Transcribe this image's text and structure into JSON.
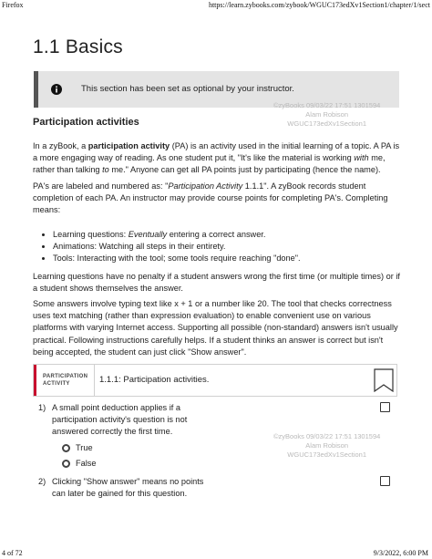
{
  "print_header": {
    "browser": "Firefox",
    "url": "https://learn.zybooks.com/zybook/WGUC173edXv1Section1/chapter/1/sect"
  },
  "print_footer": {
    "page": "4 of 72",
    "datetime": "9/3/2022, 6:00 PM"
  },
  "page_title": "1.1 Basics",
  "notice": {
    "text": "This section has been set as optional by your instructor.",
    "icon": "info-icon"
  },
  "watermarks": [
    {
      "line1": "©zyBooks 09/03/22 17:51 1301594",
      "line2": "Alam Robison",
      "line3": "WGUC173edXv1Section1"
    },
    {
      "line1": "©zyBooks 09/03/22 17:51 1301594",
      "line2": "Alam Robison",
      "line3": "WGUC173edXv1Section1"
    }
  ],
  "section_heading": "Participation activities",
  "paragraphs": {
    "p1_a": "In a zyBook, a ",
    "p1_bold": "participation activity",
    "p1_b": " (PA) is an activity used in the initial learning of a topic. A PA is a more engaging way of reading. As one student put it, \"It's like the material is working ",
    "p1_em1": "with",
    "p1_c": " me, rather than talking ",
    "p1_em2": "to",
    "p1_d": " me.\" Anyone can get all PA points just by participating (hence the name).",
    "p2_a": "PA's are labeled and numbered as: \"",
    "p2_em": "Participation Activity",
    "p2_b": " 1.1.1\". A zyBook records student completion of each PA. An instructor may provide course points for completing PA's. Completing means:",
    "p3": "Learning questions have no penalty if a student answers wrong the first time (or multiple times) or if a student shows themselves the answer.",
    "p4": "Some answers involve typing text like x + 1 or a number like 20. The tool that checks correctness uses text matching (rather than expression evaluation) to enable convenient use on various platforms with varying Internet access. Supporting all possible (non-standard) answers isn't usually practical. Following instructions carefully helps. If a student thinks an answer is correct but isn't being accepted, the student can just click \"Show answer\"."
  },
  "bullets": [
    {
      "a": "Learning questions: ",
      "em": "Eventually",
      "b": " entering a correct answer."
    },
    {
      "a": "Animations: Watching all steps in their entirety.",
      "em": "",
      "b": ""
    },
    {
      "a": "Tools: Interacting with the tool; some tools require reaching \"done\".",
      "em": "",
      "b": ""
    }
  ],
  "participation_activity": {
    "label_line1": "PARTICIPATION",
    "label_line2": "ACTIVITY",
    "title": "1.1.1: Participation activities.",
    "accent_color": "#c8102e"
  },
  "questions": [
    {
      "number": "1)",
      "text": "A small point deduction applies if a participation activity's question is not answered correctly the first time.",
      "options": [
        "True",
        "False"
      ]
    },
    {
      "number": "2)",
      "text": "Clicking \"Show answer\" means no points can later be gained for this question.",
      "options": []
    }
  ]
}
